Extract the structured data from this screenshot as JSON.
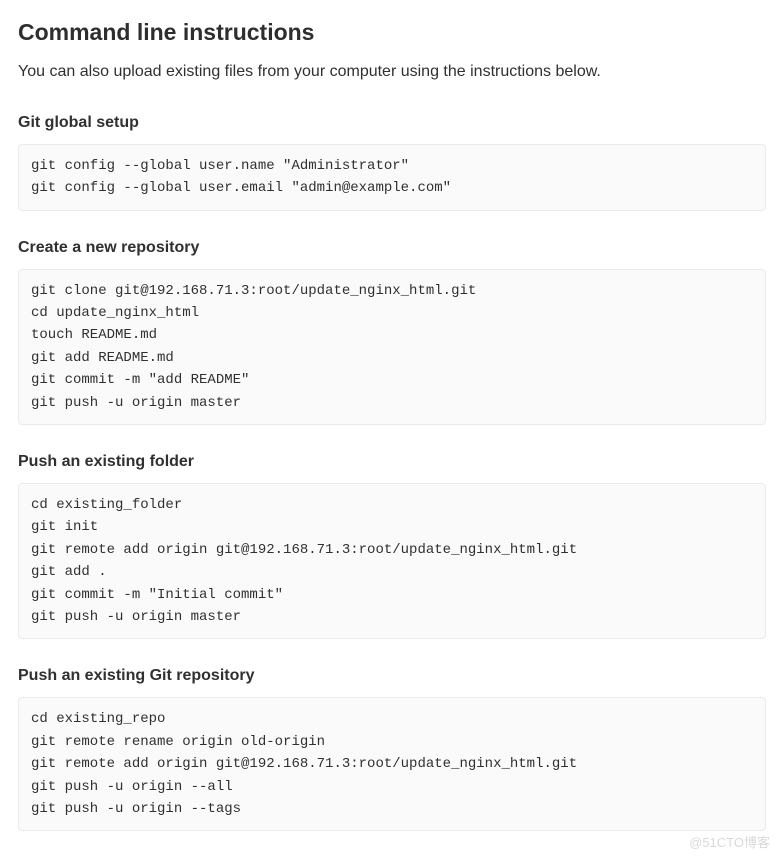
{
  "heading": "Command line instructions",
  "description": "You can also upload existing files from your computer using the instructions below.",
  "sections": [
    {
      "title": "Git global setup",
      "code": "git config --global user.name \"Administrator\"\ngit config --global user.email \"admin@example.com\""
    },
    {
      "title": "Create a new repository",
      "code": "git clone git@192.168.71.3:root/update_nginx_html.git\ncd update_nginx_html\ntouch README.md\ngit add README.md\ngit commit -m \"add README\"\ngit push -u origin master"
    },
    {
      "title": "Push an existing folder",
      "code": "cd existing_folder\ngit init\ngit remote add origin git@192.168.71.3:root/update_nginx_html.git\ngit add .\ngit commit -m \"Initial commit\"\ngit push -u origin master"
    },
    {
      "title": "Push an existing Git repository",
      "code": "cd existing_repo\ngit remote rename origin old-origin\ngit remote add origin git@192.168.71.3:root/update_nginx_html.git\ngit push -u origin --all\ngit push -u origin --tags"
    }
  ],
  "watermark": "@51CTO博客"
}
